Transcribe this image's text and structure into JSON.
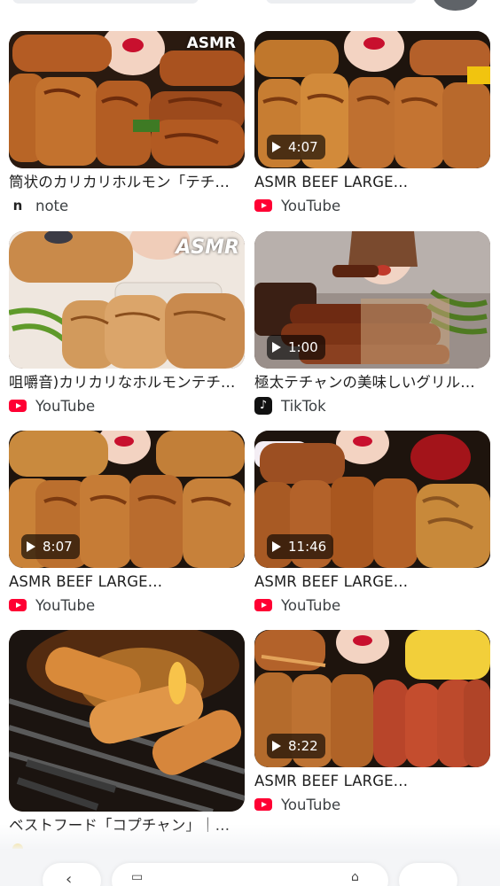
{
  "results": [
    {
      "title": "筒状のカリカリホルモン「テチ…",
      "source": "note",
      "source_icon": "note-icon",
      "duration": "",
      "watermark": "ASMR"
    },
    {
      "title": "ASMR BEEF LARGE…",
      "source": "YouTube",
      "source_icon": "youtube-icon",
      "duration": "4:07",
      "watermark": ""
    },
    {
      "title": "咀嚼音)カリカリなホルモンテチ…",
      "source": "YouTube",
      "source_icon": "youtube-icon",
      "duration": "",
      "watermark": "ASMR"
    },
    {
      "title": "極太テチャンの美味しいグリル…",
      "source": "TikTok",
      "source_icon": "tiktok-icon",
      "duration": "1:00",
      "watermark": ""
    },
    {
      "title": "ASMR BEEF LARGE…",
      "source": "YouTube",
      "source_icon": "youtube-icon",
      "duration": "8:07",
      "watermark": ""
    },
    {
      "title": "ASMR BEEF LARGE…",
      "source": "YouTube",
      "source_icon": "youtube-icon",
      "duration": "11:46",
      "watermark": ""
    },
    {
      "title": "ベストフード「コプチャン」｜…",
      "source": "",
      "source_icon": "site-icon",
      "duration": "",
      "watermark": ""
    },
    {
      "title": "ASMR BEEF LARGE…",
      "source": "YouTube",
      "source_icon": "youtube-icon",
      "duration": "8:22",
      "watermark": ""
    }
  ],
  "colors": {
    "youtube_red": "#ff0033",
    "overlay": "#000000",
    "background": "#ffffff"
  }
}
